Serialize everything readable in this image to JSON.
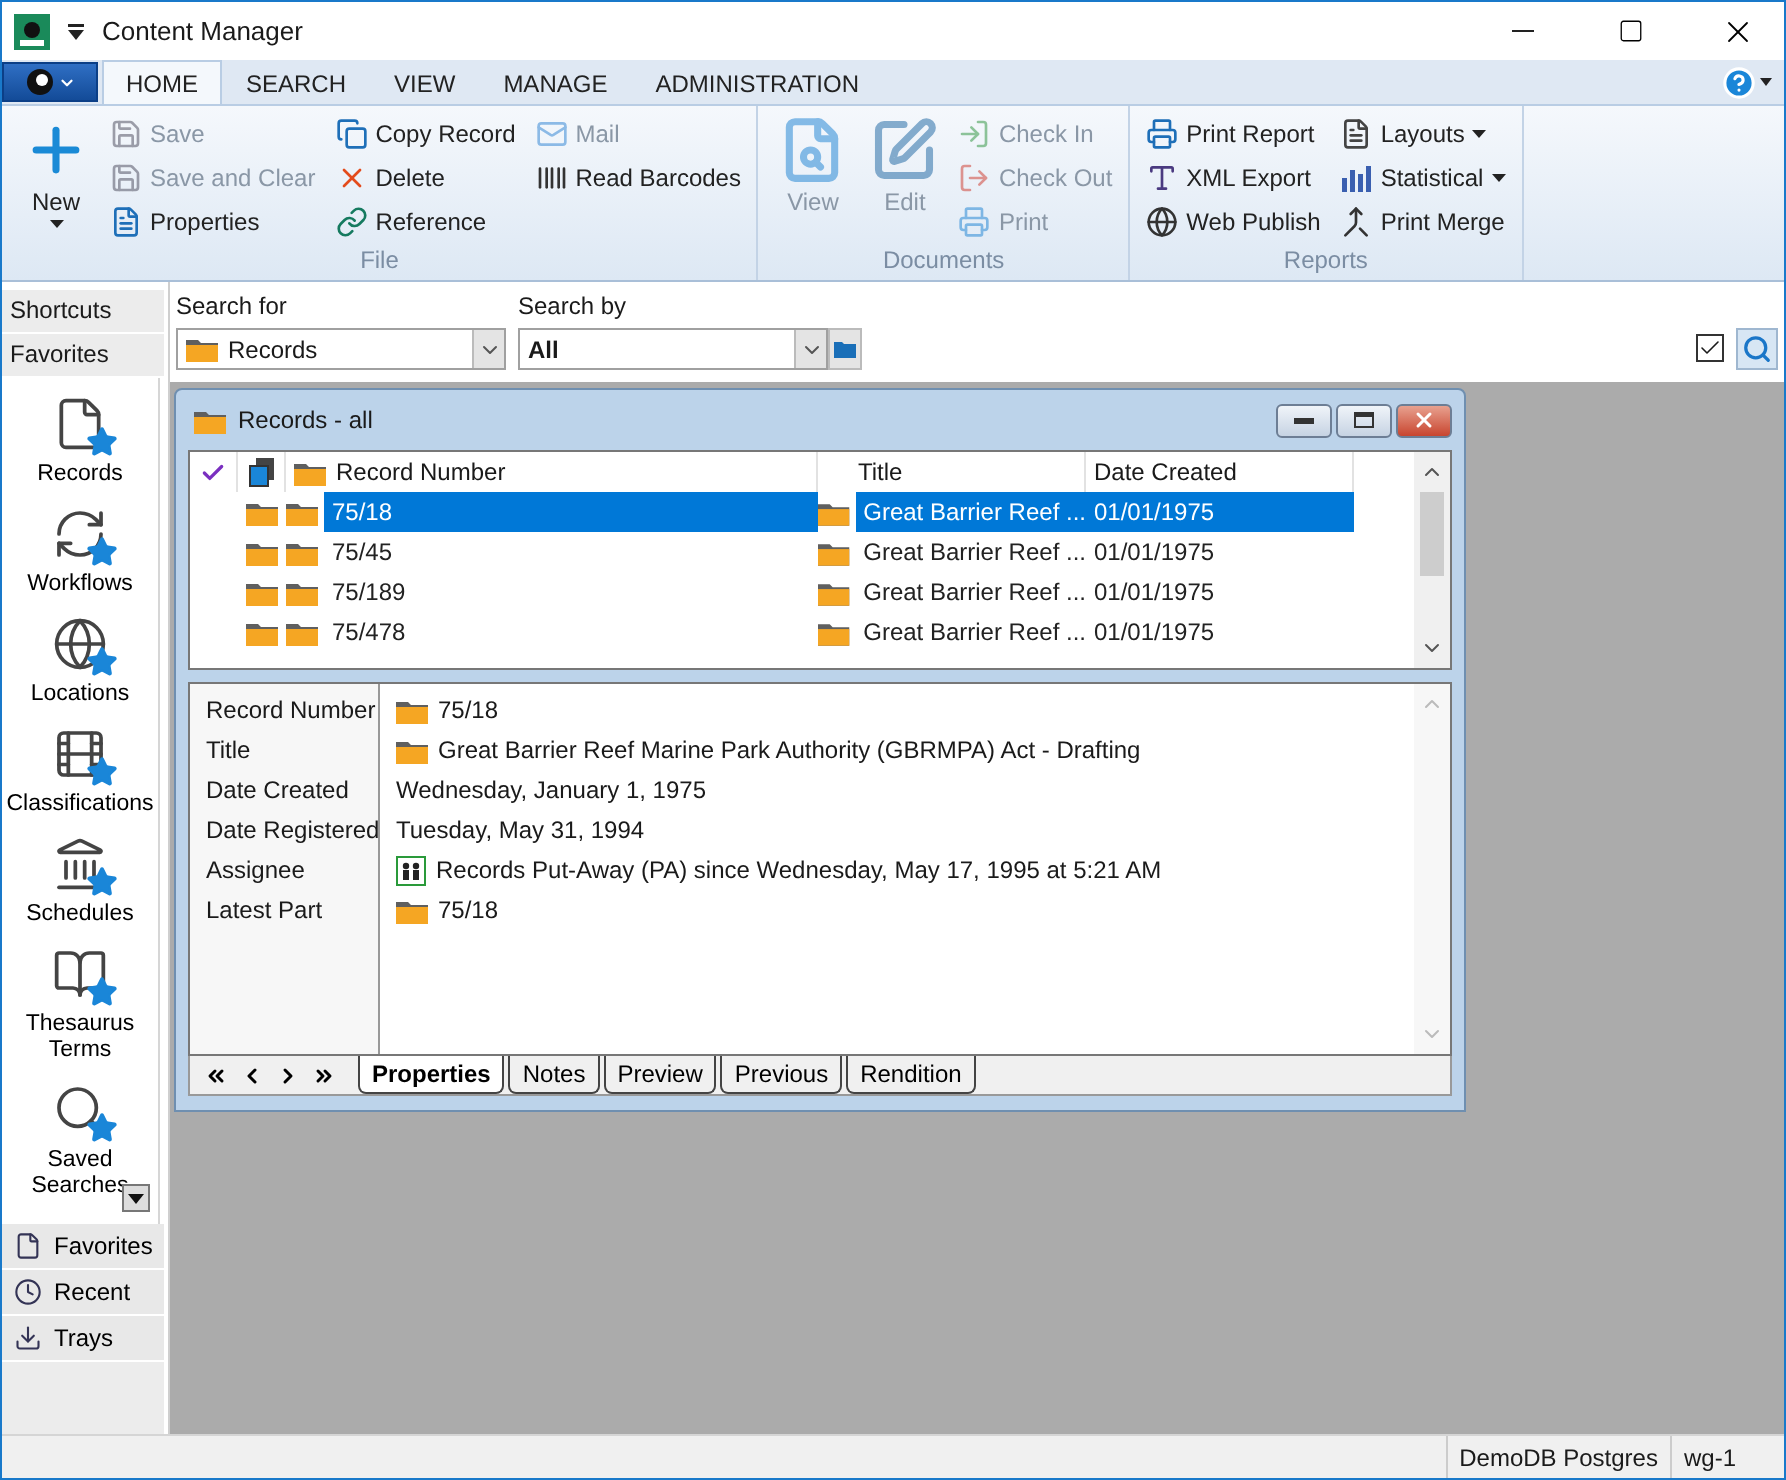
{
  "window": {
    "title": "Content Manager"
  },
  "ribbon": {
    "tabs": [
      {
        "label": "HOME",
        "selected": true
      },
      {
        "label": "SEARCH",
        "selected": false
      },
      {
        "label": "VIEW",
        "selected": false
      },
      {
        "label": "MANAGE",
        "selected": false
      },
      {
        "label": "ADMINISTRATION",
        "selected": false
      }
    ],
    "groups": [
      {
        "title": "File",
        "items": [
          {
            "label": "New",
            "kind": "large",
            "dropdown": true,
            "disabled": false
          },
          {
            "label": "Save",
            "kind": "small",
            "dropdown": false,
            "disabled": true
          },
          {
            "label": "Save and Clear",
            "kind": "small",
            "dropdown": false,
            "disabled": true
          },
          {
            "label": "Properties",
            "kind": "small",
            "dropdown": false,
            "disabled": false
          },
          {
            "label": "Copy Record",
            "kind": "small",
            "dropdown": false,
            "disabled": false
          },
          {
            "label": "Delete",
            "kind": "small",
            "dropdown": false,
            "disabled": false
          },
          {
            "label": "Reference",
            "kind": "small",
            "dropdown": false,
            "disabled": false
          },
          {
            "label": "Mail",
            "kind": "small",
            "dropdown": false,
            "disabled": true
          },
          {
            "label": "Read Barcodes",
            "kind": "small",
            "dropdown": false,
            "disabled": false
          }
        ]
      },
      {
        "title": "Documents",
        "items": [
          {
            "label": "View",
            "kind": "large",
            "dropdown": false,
            "disabled": true
          },
          {
            "label": "Edit",
            "kind": "large",
            "dropdown": false,
            "disabled": true
          },
          {
            "label": "Check In",
            "kind": "small",
            "dropdown": false,
            "disabled": true
          },
          {
            "label": "Check Out",
            "kind": "small",
            "dropdown": false,
            "disabled": true
          },
          {
            "label": "Print",
            "kind": "small",
            "dropdown": false,
            "disabled": true
          }
        ]
      },
      {
        "title": "Reports",
        "items": [
          {
            "label": "Print Report",
            "kind": "small",
            "dropdown": false,
            "disabled": false
          },
          {
            "label": "XML Export",
            "kind": "small",
            "dropdown": false,
            "disabled": false
          },
          {
            "label": "Web Publish",
            "kind": "small",
            "dropdown": false,
            "disabled": false
          },
          {
            "label": "Layouts",
            "kind": "small",
            "dropdown": true,
            "disabled": false
          },
          {
            "label": "Statistical",
            "kind": "small",
            "dropdown": true,
            "disabled": false
          },
          {
            "label": "Print Merge",
            "kind": "small",
            "dropdown": false,
            "disabled": false
          }
        ]
      }
    ]
  },
  "sidebar": {
    "headers": [
      "Shortcuts",
      "Favorites"
    ],
    "items": [
      {
        "label": "Records"
      },
      {
        "label": "Workflows"
      },
      {
        "label": "Locations"
      },
      {
        "label": "Classifications"
      },
      {
        "label": "Schedules"
      },
      {
        "label": "Thesaurus Terms"
      },
      {
        "label": "Saved Searches"
      }
    ],
    "sections": [
      {
        "label": "Favorites"
      },
      {
        "label": "Recent"
      },
      {
        "label": "Trays"
      }
    ]
  },
  "search": {
    "search_for": {
      "label": "Search for",
      "value": "Records"
    },
    "search_by": {
      "label": "Search by",
      "value": "All"
    },
    "checked": true
  },
  "records_window": {
    "title": "Records - all",
    "columns": [
      "Record Number",
      "Title",
      "Date Created"
    ],
    "rows": [
      {
        "record_number": "75/18",
        "title": "Great Barrier Reef ...",
        "date_created": "01/01/1975",
        "selected": true
      },
      {
        "record_number": "75/45",
        "title": "Great Barrier Reef ...",
        "date_created": "01/01/1975",
        "selected": false
      },
      {
        "record_number": "75/189",
        "title": "Great Barrier Reef ...",
        "date_created": "01/01/1975",
        "selected": false
      },
      {
        "record_number": "75/478",
        "title": "Great Barrier Reef ...",
        "date_created": "01/01/1975",
        "selected": false
      }
    ],
    "properties": [
      {
        "label": "Record Number",
        "value": "75/18",
        "kind": "folder"
      },
      {
        "label": "Title",
        "value": "Great Barrier Reef Marine Park Authority (GBRMPA) Act - Drafting",
        "kind": "folder"
      },
      {
        "label": "Date Created",
        "value": "Wednesday, January 1, 1975",
        "kind": "plain"
      },
      {
        "label": "Date Registered",
        "value": "Tuesday, May 31, 1994",
        "kind": "plain"
      },
      {
        "label": "Assignee",
        "value": "Records Put-Away (PA) since Wednesday, May 17, 1995 at 5:21 AM",
        "kind": "assignee"
      },
      {
        "label": "Latest Part",
        "value": "75/18",
        "kind": "folder"
      }
    ],
    "tabs": [
      {
        "label": "Properties",
        "selected": true
      },
      {
        "label": "Notes",
        "selected": false
      },
      {
        "label": "Preview",
        "selected": false
      },
      {
        "label": "Previous",
        "selected": false
      },
      {
        "label": "Rendition",
        "selected": false
      }
    ]
  },
  "status_bar": [
    "DemoDB Postgres",
    "wg-1"
  ]
}
